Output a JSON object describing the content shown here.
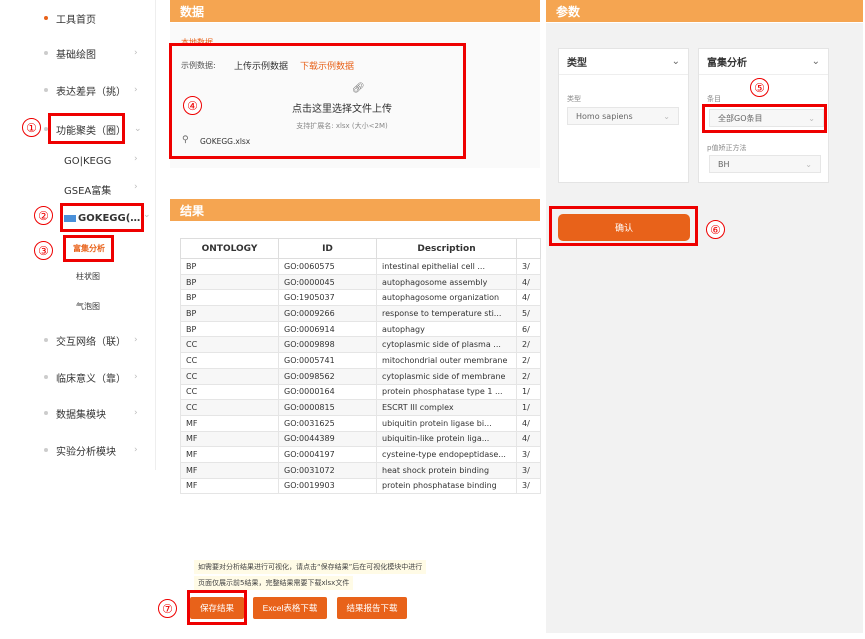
{
  "sidebar": {
    "items": [
      {
        "label": "工具首页"
      },
      {
        "label": "基础绘图"
      },
      {
        "label": "表达差异（挑）"
      },
      {
        "label": "功能聚类（圈）"
      },
      {
        "label": "交互网络（联）"
      },
      {
        "label": "临床意义（靠）"
      },
      {
        "label": "数据集模块"
      },
      {
        "label": "实验分析模块"
      }
    ],
    "sub_items": [
      {
        "label": "GO|KEGG"
      },
      {
        "label": "GSEA富集"
      },
      {
        "label": "GOKEGG(…"
      }
    ],
    "sub_sub_items": [
      {
        "label": "富集分析"
      },
      {
        "label": "柱状图"
      },
      {
        "label": "气泡图"
      }
    ]
  },
  "annotations": [
    "①",
    "②",
    "③",
    "④",
    "⑤",
    "⑥",
    "⑦"
  ],
  "data_panel": {
    "title": "数据",
    "local_data_tab": "本地数据",
    "example_label": "示例数据:",
    "upload_example": "上传示例数据",
    "download_example": "下载示例数据",
    "upload_prompt": "点击这里选择文件上传",
    "upload_hint": "支持扩展名: xlsx (大小<2M)",
    "file_name": "GOKEGG.xlsx"
  },
  "params_panel": {
    "title": "参数",
    "type_card": {
      "title": "类型",
      "field_label": "类型",
      "value": "Homo sapiens"
    },
    "enrich_card": {
      "title": "富集分析",
      "term_label": "条目",
      "term_value": "全部GO条目",
      "padj_label": "p值矫正方法",
      "padj_value": "BH"
    },
    "confirm_label": "确认"
  },
  "result_panel": {
    "title": "结果",
    "columns": [
      "ONTOLOGY",
      "ID",
      "Description",
      ""
    ],
    "rows": [
      {
        "ontology": "BP",
        "id": "GO:0060575",
        "desc": "intestinal epithelial cell ...",
        "extra": "3/"
      },
      {
        "ontology": "BP",
        "id": "GO:0000045",
        "desc": "autophagosome assembly",
        "extra": "4/"
      },
      {
        "ontology": "BP",
        "id": "GO:1905037",
        "desc": "autophagosome organization",
        "extra": "4/"
      },
      {
        "ontology": "BP",
        "id": "GO:0009266",
        "desc": "response to temperature sti...",
        "extra": "5/"
      },
      {
        "ontology": "BP",
        "id": "GO:0006914",
        "desc": "autophagy",
        "extra": "6/"
      },
      {
        "ontology": "CC",
        "id": "GO:0009898",
        "desc": "cytoplasmic side of plasma ...",
        "extra": "2/"
      },
      {
        "ontology": "CC",
        "id": "GO:0005741",
        "desc": "mitochondrial outer membrane",
        "extra": "2/"
      },
      {
        "ontology": "CC",
        "id": "GO:0098562",
        "desc": "cytoplasmic side of membrane",
        "extra": "2/"
      },
      {
        "ontology": "CC",
        "id": "GO:0000164",
        "desc": "protein phosphatase type 1 ...",
        "extra": "1/"
      },
      {
        "ontology": "CC",
        "id": "GO:0000815",
        "desc": "ESCRT III complex",
        "extra": "1/"
      },
      {
        "ontology": "MF",
        "id": "GO:0031625",
        "desc": "ubiquitin protein ligase bi...",
        "extra": "4/"
      },
      {
        "ontology": "MF",
        "id": "GO:0044389",
        "desc": "ubiquitin-like protein liga...",
        "extra": "4/"
      },
      {
        "ontology": "MF",
        "id": "GO:0004197",
        "desc": "cysteine-type endopeptidase...",
        "extra": "3/"
      },
      {
        "ontology": "MF",
        "id": "GO:0031072",
        "desc": "heat shock protein binding",
        "extra": "3/"
      },
      {
        "ontology": "MF",
        "id": "GO:0019903",
        "desc": "protein phosphatase binding",
        "extra": "3/"
      }
    ],
    "note1": "如需要对分析结果进行可视化，请点击“保存结果”后在可视化模块中进行",
    "note2": "页面仅展示前5结果，完整结果需要下载xlsx文件",
    "save_label": "保存结果",
    "excel_label": "Excel表格下载",
    "report_label": "结果报告下载"
  }
}
